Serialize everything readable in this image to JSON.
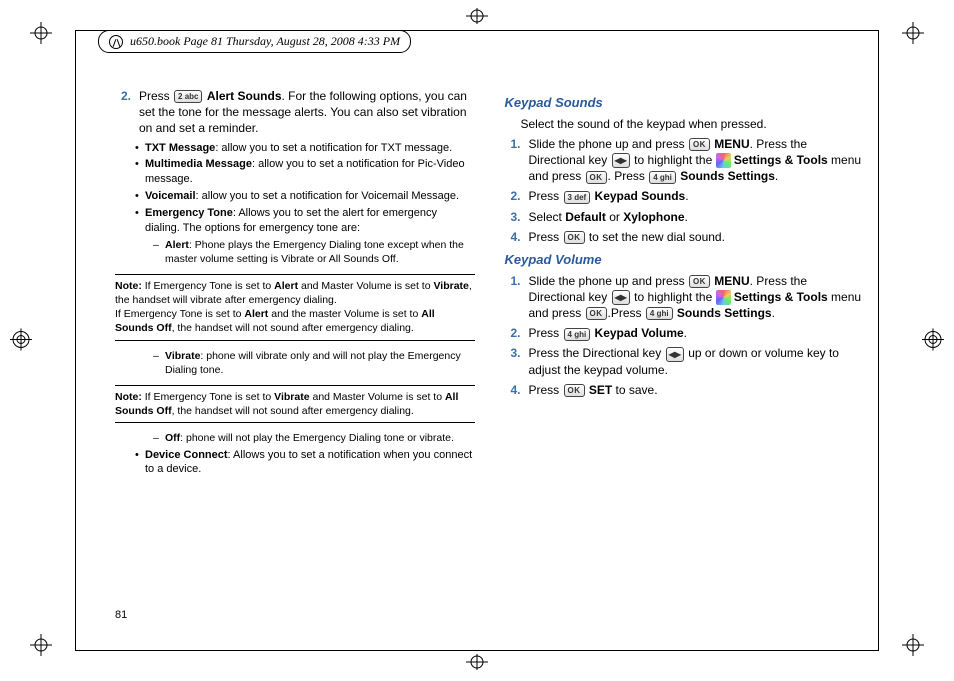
{
  "header": "u650.book  Page 81  Thursday, August 28, 2008  4:33 PM",
  "pageNumber": "81",
  "left": {
    "step2": {
      "num": "2.",
      "press": "Press ",
      "key": "2 abc",
      "bold": "Alert Sounds",
      "after": ". For the following options, you can set the tone for the message alerts. You can also set vibration on and set a reminder."
    },
    "bullets": {
      "txt_b": "TXT Message",
      "txt_r": ": allow you to set a notification for TXT message.",
      "mm_b": "Multimedia Message",
      "mm_r": ": allow you to set a notification for Pic-Video message.",
      "vm_b": "Voicemail",
      "vm_r": ": allow you to set a notification for Voicemail Message.",
      "et_b": "Emergency Tone",
      "et_r": ": Allows you to set the alert for emergency dialing. The options for emergency tone are:"
    },
    "dashes": {
      "alert_b": "Alert",
      "alert_r": ": Phone plays the Emergency Dialing tone except when the master volume setting is Vibrate or All Sounds Off.",
      "vib_b": "Vibrate",
      "vib_r": ": phone will vibrate only and will not play the Emergency Dialing tone.",
      "off_b": "Off",
      "off_r": ": phone will not play the Emergency Dialing tone or vibrate."
    },
    "note1": {
      "label": "Note:",
      "body_a": "If Emergency Tone is set to ",
      "body_b": "Alert",
      "body_c": " and Master Volume is set to ",
      "body_d": "Vibrate",
      "body_e": ", the handset will vibrate after emergency dialing.",
      "body_f": "If Emergency Tone is set to ",
      "body_g": "Alert",
      "body_h": " and the master Volume is set to ",
      "body_i": "All Sounds Off",
      "body_j": ", the handset will not sound after emergency dialing."
    },
    "note2": {
      "label": "Note:",
      "body_a": "If Emergency Tone is set to ",
      "body_b": "Vibrate",
      "body_c": " and Master Volume is set to ",
      "body_d": "All Sounds Off",
      "body_e": ", the handset will not sound after emergency dialing."
    },
    "device": {
      "b": "Device Connect",
      "r": ": Allows you to set a notification when you connect to a device."
    }
  },
  "right": {
    "ks_title": "Keypad Sounds",
    "ks_intro": "Select the sound of the keypad when pressed.",
    "ks1": {
      "num": "1.",
      "a": "Slide the phone up and press ",
      "okKey": "OK",
      "b": "MENU",
      "c": ". Press the Directional key ",
      "navKey": "◀▶",
      "d": " to highlight the ",
      "e": "Settings & Tools",
      "f": " menu and press ",
      "g": ". Press ",
      "key4": "4 ghi",
      "h": "Sounds Settings",
      "i": "."
    },
    "ks2": {
      "num": "2.",
      "a": "Press ",
      "key": "3 def",
      "b": "Keypad Sounds",
      "c": "."
    },
    "ks3": {
      "num": "3.",
      "a": "Select ",
      "b": "Default",
      "c": " or ",
      "d": "Xylophone",
      "e": "."
    },
    "ks4": {
      "num": "4.",
      "a": "Press ",
      "okKey": "OK",
      "b": " to set the new dial sound."
    },
    "kv_title": "Keypad Volume",
    "kv1": {
      "num": "1.",
      "a": "Slide the phone up and press ",
      "okKey": "OK",
      "b": "MENU",
      "c": ". Press the Directional key ",
      "navKey": "◀▶",
      "d": " to highlight the ",
      "e": "Settings & Tools",
      "f": " menu and press ",
      "g": ".Press ",
      "key4": "4 ghi",
      "h": "Sounds Settings",
      "i": "."
    },
    "kv2": {
      "num": "2.",
      "a": "Press ",
      "key": "4 ghi",
      "b": "Keypad Volume",
      "c": "."
    },
    "kv3": {
      "num": "3.",
      "a": "Press the Directional key ",
      "navKey": "◀▶",
      "b": " up or down or volume key to adjust the keypad volume."
    },
    "kv4": {
      "num": "4.",
      "a": "Press ",
      "okKey": "OK",
      "b": "SET",
      "c": " to save."
    }
  }
}
